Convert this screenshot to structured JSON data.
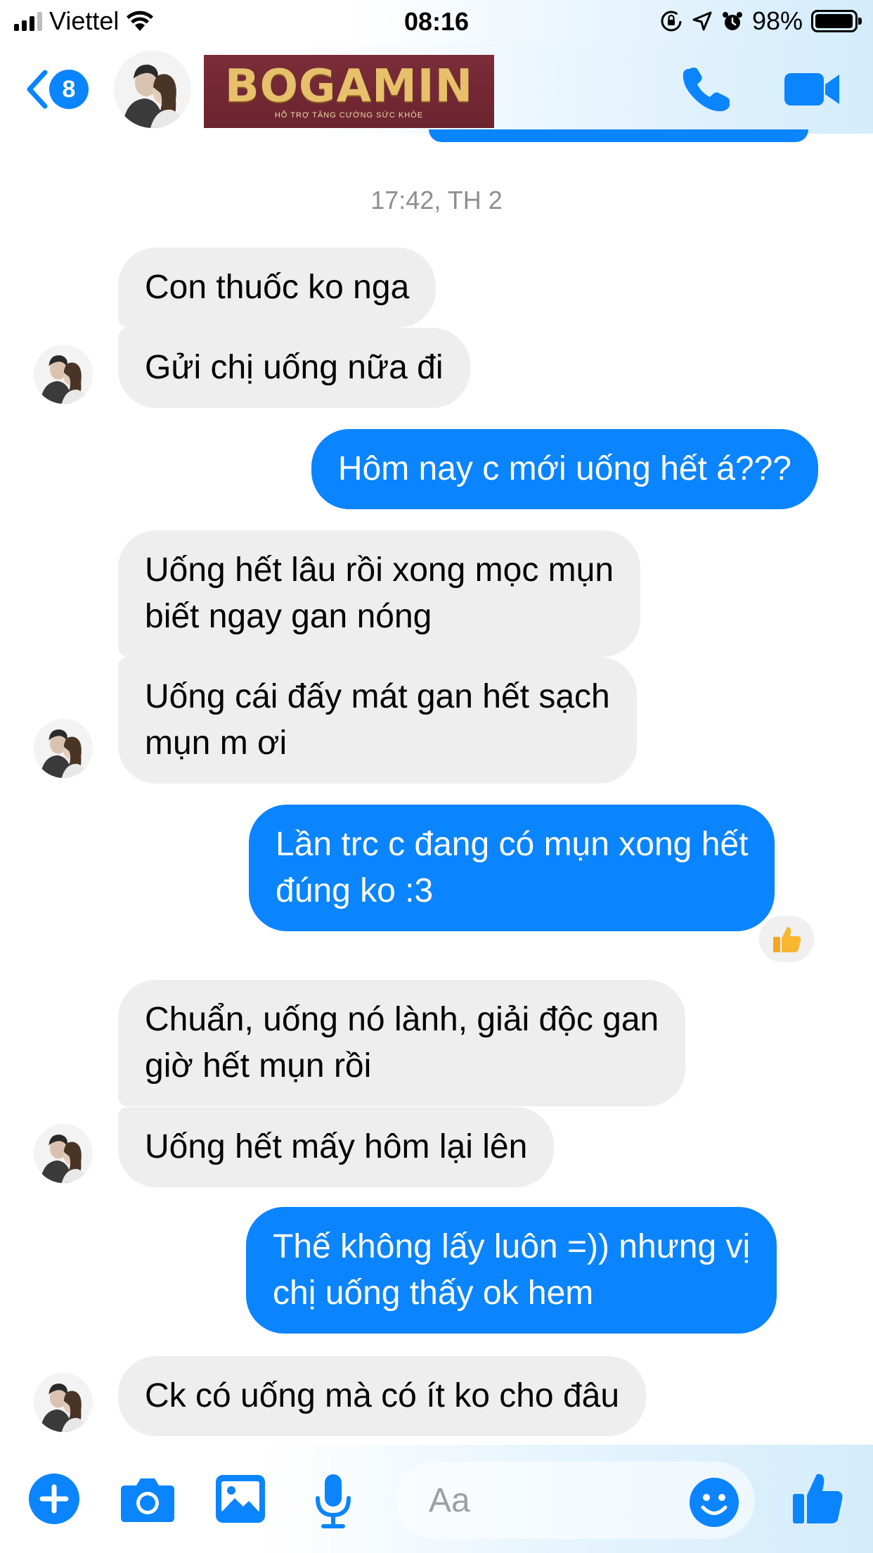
{
  "status_bar": {
    "carrier": "Viettel",
    "time": "08:16",
    "battery": "98%",
    "battery_level": 0.98
  },
  "header": {
    "unread_count": "8",
    "brand_name": "BOGAMIN",
    "brand_tagline": "HỖ TRỢ TĂNG CƯỜNG SỨC KHỎE",
    "icons": [
      "back-chevron-icon",
      "phone-icon",
      "video-camera-icon"
    ]
  },
  "chat": {
    "timestamp": "17:42, TH 2",
    "messages": [
      {
        "side": "in",
        "text": "Con thuốc ko nga"
      },
      {
        "side": "in",
        "text": "Gửi chị uống nữa đi"
      },
      {
        "side": "out",
        "text": "Hôm nay c mới uống hết á???"
      },
      {
        "side": "in",
        "line1": "Uống hết lâu rồi xong mọc mụn",
        "line2": "biết ngay gan nóng"
      },
      {
        "side": "in",
        "line1": "Uống cái đấy mát gan hết sạch",
        "line2": "mụn m ơi"
      },
      {
        "side": "out",
        "line1": "Lần trc c đang có mụn xong hết",
        "line2": "đúng ko :3",
        "reaction": "thumbs-up-icon"
      },
      {
        "side": "in",
        "line1": "Chuẩn, uống nó lành, giải độc gan",
        "line2": "giờ hết mụn rồi"
      },
      {
        "side": "in",
        "text": "Uống hết mấy hôm lại lên"
      },
      {
        "side": "out",
        "line1": "Thế không lấy luôn =)) nhưng vị",
        "line2": "chị uống thấy ok hem"
      },
      {
        "side": "in",
        "text": "Ck có uống mà có ít ko cho đâu"
      }
    ]
  },
  "composer": {
    "placeholder": "Aa",
    "icons": [
      "plus-icon",
      "camera-icon",
      "image-icon",
      "microphone-icon",
      "emoji-icon",
      "thumbs-up-icon"
    ]
  },
  "colors": {
    "accent": "#0a84ff",
    "incoming_bubble": "#eeeeee",
    "brand_banner": "#7b2d38",
    "brand_gold": "#e6c06b"
  }
}
